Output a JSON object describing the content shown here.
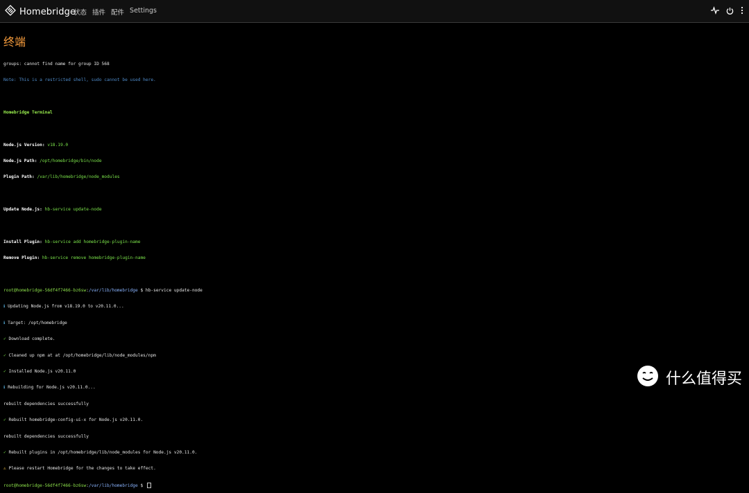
{
  "app": {
    "title": "Homebridge"
  },
  "nav": {
    "items": [
      "状态",
      "插件",
      "配件",
      "Settings"
    ]
  },
  "page": {
    "title": "终端"
  },
  "terminal": {
    "l1": "groups: cannot find name for group ID 568",
    "l2": "Note: This is a restricted shell, sudo cannot be used here.",
    "l3": "Homebridge Terminal",
    "nodeVersionLabel": "Node.js Version:",
    "nodeVersionValue": "v18.19.0",
    "nodePathLabel": "Node.js Path:",
    "nodePathValue": "/opt/homebridge/bin/node",
    "pluginPathLabel": "Plugin Path:",
    "pluginPathValue": "/var/lib/homebridge/node_modules",
    "updateLabel": "Update Node.js:",
    "updateValue": "hb-service update-node",
    "installLabel": "Install Plugin:",
    "installValue": "hb-service add homebridge-plugin-name",
    "removeLabel": "Remove Plugin:",
    "removeValue": "hb-service remove homebridge-plugin-name",
    "promptUser": "root@homebridge-56df4f7466-bz6sw",
    "promptPath": "/var/lib/homebridge",
    "cmd": "hb-service update-node",
    "o1": "Updating Node.js from v18.19.0 to v20.11.0...",
    "o2": "Target: /opt/homebridge",
    "o3": "Download complete.",
    "o4": "Cleaned up npm at at /opt/homebridge/lib/node_modules/npm",
    "o5": "Installed Node.js v20.11.0",
    "o6": "Rebuilding for Node.js v20.11.0...",
    "o7": "rebuilt dependencies successfully",
    "o8": "Rebuilt homebridge-config-ui-x for Node.js v20.11.0.",
    "o9": "rebuilt dependencies successfully",
    "o10": "Rebuilt plugins in /opt/homebridge/lib/node_modules for Node.js v20.11.0.",
    "o11": "Please restart Homebridge for the changes to take effect."
  },
  "watermark": {
    "text": "什么值得买"
  },
  "icons": {
    "brand": "homebridge-logo-icon",
    "status": "pulse-icon",
    "power": "power-icon",
    "menu": "more-vertical-icon"
  },
  "colors": {
    "accent": "#f39a3c",
    "green": "#7be34a",
    "blue": "#4f8bc9"
  }
}
